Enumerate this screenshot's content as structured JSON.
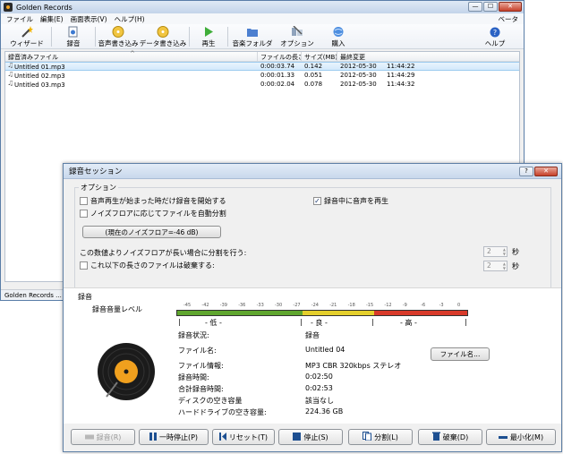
{
  "main_window": {
    "title": "Golden Records",
    "menu": [
      "ファイル",
      "編集(E)",
      "画面表示(V)",
      "ヘルプ(H)"
    ],
    "beta_label": "ベータ",
    "toolbar": {
      "wizard": "ウィザード",
      "record": "録音",
      "write_audio": "音声書き込み",
      "write_data": "データ書き込み",
      "play": "再生",
      "music_folder": "音楽フォルダ",
      "options": "オプション",
      "purchase": "購入",
      "help": "ヘルプ"
    },
    "columns": [
      "録音済みファイル",
      "ファイルの長さ",
      "サイズ(MB)",
      "最終変更"
    ],
    "files": [
      {
        "name": "Untitled 01.mp3",
        "length": "0:00:03.74",
        "size": "0.142",
        "date": "2012-05-30",
        "time": "11:44:22"
      },
      {
        "name": "Untitled 02.mp3",
        "length": "0:00:01.33",
        "size": "0.051",
        "date": "2012-05-30",
        "time": "11:44:29"
      },
      {
        "name": "Untitled 03.mp3",
        "length": "0:00:02.04",
        "size": "0.078",
        "date": "2012-05-30",
        "time": "11:44:32"
      }
    ],
    "status": "Golden Records ..."
  },
  "dialog": {
    "title": "録音セッション",
    "help_btn": "?",
    "options_legend": "オプション",
    "opt_start_on_sound": "音声再生が始まった時だけ録音を開始する",
    "opt_auto_split": "ノイズフロアに応じてファイルを自動分割",
    "opt_play_while_rec": "録音中に音声を再生",
    "noise_floor_button": "(現在のノイズフロア=-46 dB)",
    "split_label": "この数値よりノイズフロアが長い場合に分割を行う:",
    "discard_label": "これ以下の長さのファイルは破棄する:",
    "split_value": "2",
    "discard_value": "2",
    "seconds_unit": "秒",
    "recording_header": "録音",
    "level_label": "録音音量レベル",
    "meter_ticks": [
      "-45",
      "-42",
      "-39",
      "-36",
      "-33",
      "-30",
      "-27",
      "-24",
      "-21",
      "-18",
      "-15",
      "-12",
      "-9",
      "-6",
      "-3",
      "0"
    ],
    "meter_low": "- 低 -",
    "meter_mid": "- 良 -",
    "meter_high": "- 高 -",
    "info": {
      "status_key": "録音状況:",
      "status_val": "録音",
      "filename_key": "ファイル名:",
      "filename_val": "Untitled 04",
      "fileinfo_key": "ファイル情報:",
      "fileinfo_val": "MP3 CBR 320kbps ステレオ",
      "rectime_key": "録音時間:",
      "rectime_val": "0:02:50",
      "total_key": "合計録音時間:",
      "total_val": "0:02:53",
      "disk_key": "ディスクの空き容量",
      "disk_val": "該当なし",
      "hdd_key": "ハードドライブの空き容量:",
      "hdd_val": "224.36 GB"
    },
    "filename_button": "ファイル名...",
    "buttons": {
      "record": "録音(R)",
      "pause": "一時停止(P)",
      "reset": "リセット(T)",
      "stop": "停止(S)",
      "split": "分割(L)",
      "discard": "破棄(D)",
      "minimize": "最小化(M)"
    },
    "colors": {
      "accent": "#1d4f91",
      "meter_green": "#5fa62e",
      "meter_yellow": "#e4cf2c",
      "meter_red": "#d83a2a",
      "disc_label": "#f0a01e"
    }
  }
}
